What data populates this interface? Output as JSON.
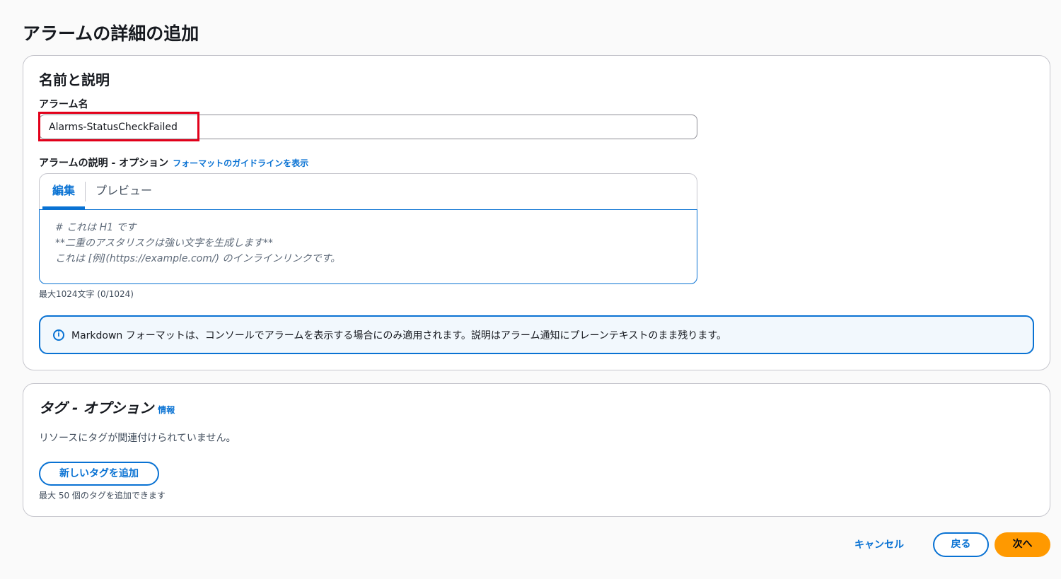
{
  "page": {
    "title": "アラームの詳細の追加"
  },
  "name_section": {
    "title": "名前と説明",
    "alarm_name_label": "アラーム名",
    "alarm_name_value": "Alarms-StatusCheckFailed",
    "description_label": "アラームの説明 - オプション",
    "format_guide_link": "フォーマットのガイドラインを表示",
    "tabs": [
      {
        "label": "編集",
        "active": true
      },
      {
        "label": "プレビュー",
        "active": false
      }
    ],
    "placeholder_lines": [
      "# これは H1 です",
      "**二重のアスタリスクは強い文字を生成します**",
      "これは [例](https://example.com/) のインラインリンクです。"
    ],
    "char_count": "最大1024文字 (0/1024)",
    "info_text": "Markdown フォーマットは、コンソールでアラームを表示する場合にのみ適用されます。説明はアラーム通知にプレーンテキストのまま残ります。",
    "info_icon": "info-icon"
  },
  "tags_section": {
    "title": "タグ - オプション",
    "info_link": "情報",
    "empty_text": "リソースにタグが関連付けられていません。",
    "add_button": "新しいタグを追加",
    "hint": "最大 50 個のタグを追加できます"
  },
  "footer": {
    "cancel": "キャンセル",
    "back": "戻る",
    "next": "次へ"
  },
  "colors": {
    "accent": "#0972d3",
    "primary_button": "#ff9900",
    "highlight": "#e2001a"
  }
}
